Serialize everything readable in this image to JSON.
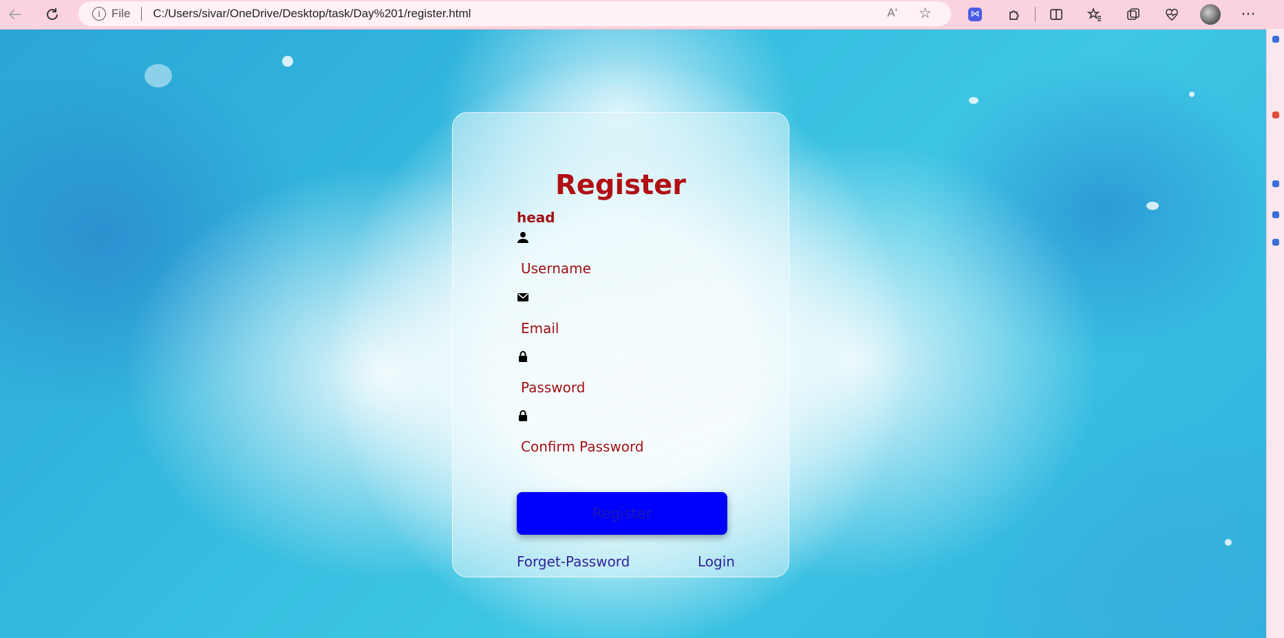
{
  "browser": {
    "scheme": "File",
    "url": "C:/Users/sivar/OneDrive/Desktop/task/Day%201/register.html",
    "read_aloud_label": "Aʹ"
  },
  "form": {
    "title": "Register",
    "head_label": "head",
    "fields": [
      {
        "icon": "user-icon",
        "placeholder": "Username"
      },
      {
        "icon": "envelope-icon",
        "placeholder": "Email"
      },
      {
        "icon": "lock-icon",
        "placeholder": "Password"
      },
      {
        "icon": "lock-icon",
        "placeholder": "Confirm Password"
      }
    ],
    "submit_label": "Register",
    "forget_link": "Forget-Password",
    "login_link": "Login"
  },
  "colors": {
    "title": "#b00f14",
    "button": "#0000ff",
    "link": "#32229a",
    "browser_bar": "#fbd3df"
  }
}
